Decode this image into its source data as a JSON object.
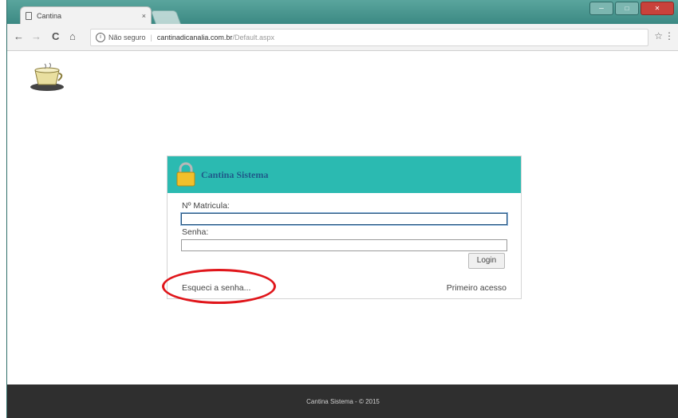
{
  "browser": {
    "tab_title": "Cantina",
    "tab_close": "×",
    "security_label": "Não seguro",
    "url_host": "cantinadicanalia.com.br",
    "url_path": "/Default.aspx",
    "back": "←",
    "forward": "→",
    "reload": "C",
    "home": "⌂",
    "star": "☆",
    "menu": "⋮",
    "info": "i",
    "window_controls": {
      "minimize": "─",
      "maximize": "□",
      "close": "✕"
    }
  },
  "login": {
    "header_title": "Cantina Sistema",
    "matricula_label": "Nº Matricula:",
    "matricula_value": "",
    "senha_label": "Senha:",
    "senha_value": "",
    "login_button": "Login",
    "forgot_link": "Esqueci a senha...",
    "first_access_link": "Primeiro acesso"
  },
  "footer": {
    "text": "Cantina Sistema - © 2015"
  },
  "colors": {
    "header_teal": "#2bbab1",
    "annotation_red": "#e0161b",
    "footer_bg": "#2f2f2f"
  }
}
